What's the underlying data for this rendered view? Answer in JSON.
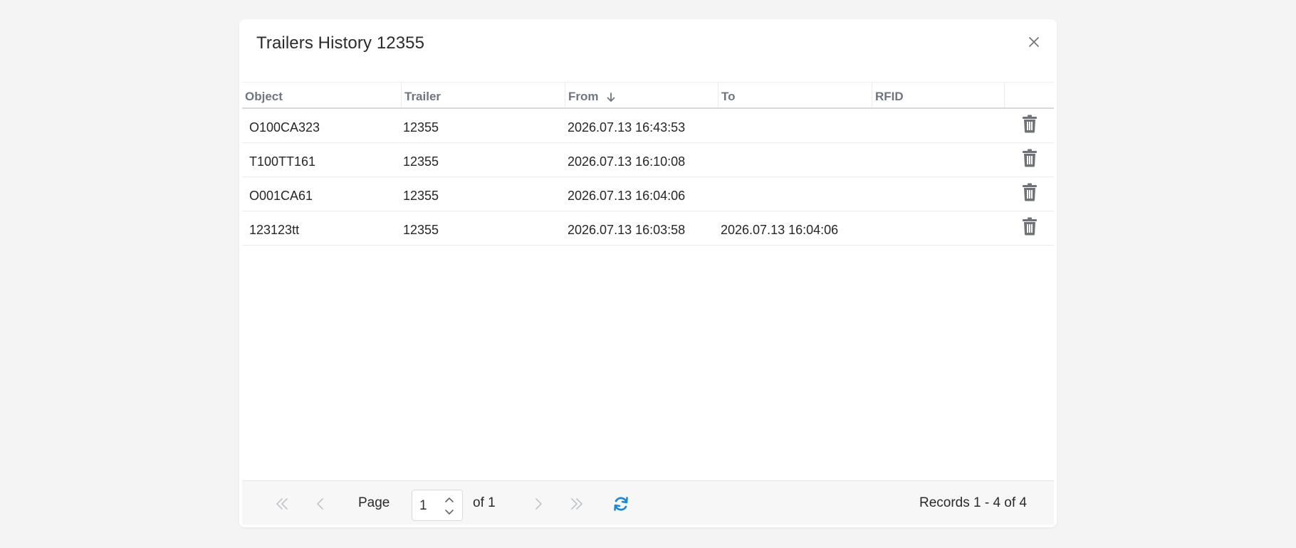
{
  "dialog": {
    "title": "Trailers History 12355"
  },
  "grid": {
    "columns": {
      "object": "Object",
      "trailer": "Trailer",
      "from": "From",
      "to": "To",
      "rfid": "RFID"
    },
    "rows": [
      {
        "object": "O100CA323",
        "trailer": "12355",
        "from": "2026.07.13 16:43:53",
        "to": "",
        "rfid": ""
      },
      {
        "object": "T100TT161",
        "trailer": "12355",
        "from": "2026.07.13 16:10:08",
        "to": "",
        "rfid": ""
      },
      {
        "object": "O001CA61",
        "trailer": "12355",
        "from": "2026.07.13 16:04:06",
        "to": "",
        "rfid": ""
      },
      {
        "object": "123123tt",
        "trailer": "12355",
        "from": "2026.07.13 16:03:58",
        "to": "2026.07.13 16:04:06",
        "rfid": ""
      }
    ]
  },
  "pager": {
    "page_label": "Page",
    "page_value": "1",
    "of_label": "of 1",
    "records_label": "Records 1 - 4 of 4"
  },
  "icons": {
    "close": "close-icon",
    "sort": "arrow-down-icon",
    "trash": "trash-icon",
    "first": "double-chevron-left-icon",
    "prev": "chevron-left-icon",
    "next": "chevron-right-icon",
    "last": "double-chevron-right-icon",
    "refresh": "refresh-icon"
  },
  "colors": {
    "accent": "#1e88d6",
    "icon_gray": "#6e7178",
    "disabled": "#c2c6cc"
  }
}
